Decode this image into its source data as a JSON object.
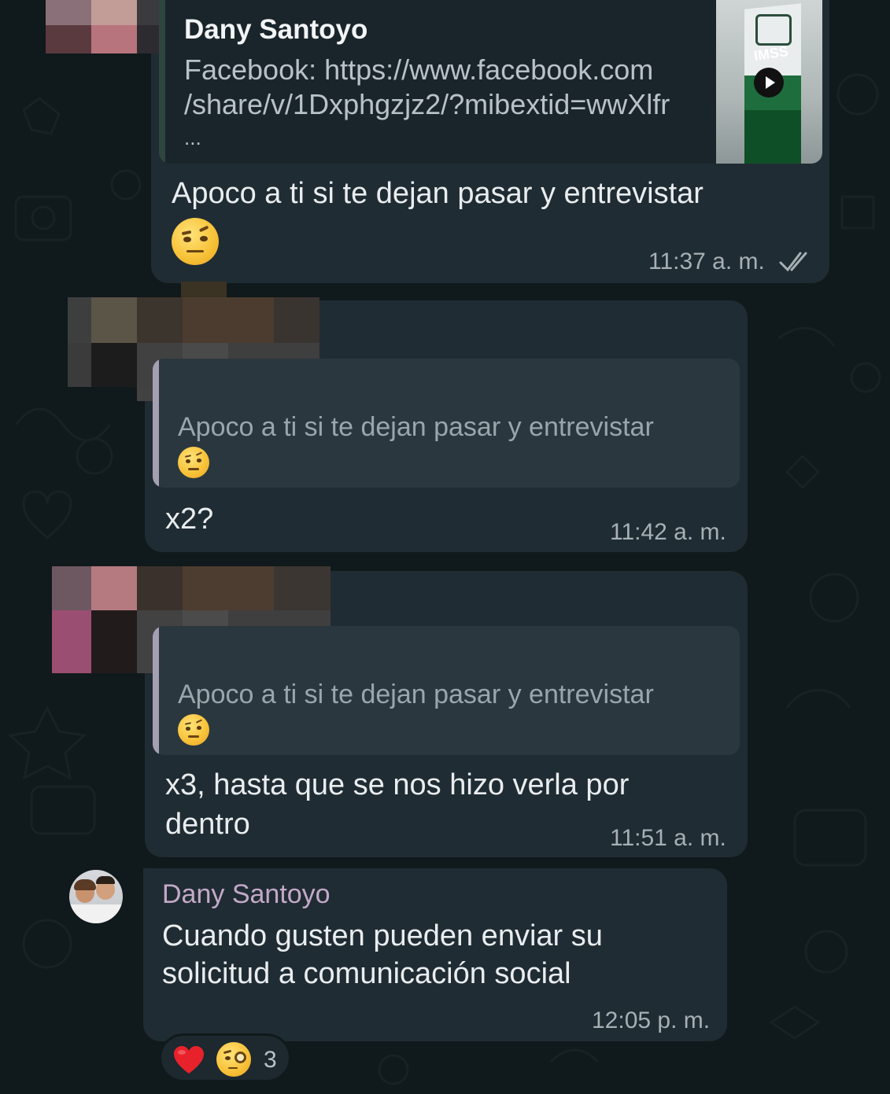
{
  "colors": {
    "background": "#10191b",
    "bubble": "#202c33",
    "quote_bg": "#2a373f",
    "quote_bar": "#a59fb2",
    "sender_name": "#c3a9c9",
    "read_ticks": "#a6b0b5"
  },
  "message1": {
    "sender": "Dany Santoyo",
    "link_line1": "Facebook: https://www.facebook.com",
    "link_line2": "/share/v/1Dxphgzjz2/?mibextid=wwXlfr",
    "link_more": "...",
    "thumbnail_logo": "IMSS",
    "thumbnail_icon": "play-icon",
    "text": "Apoco a ti si te dejan pasar y entrevistar",
    "emoji": "face-with-raised-eyebrow",
    "time": "11:37 a. m.",
    "status_icon": "double-check-icon"
  },
  "message2": {
    "quote_text": "Apoco a ti si te dejan pasar y entrevistar",
    "quote_emoji": "face-with-raised-eyebrow",
    "text": "x2?",
    "time": "11:42 a. m."
  },
  "message3": {
    "quote_text": "Apoco a ti si te dejan pasar y entrevistar",
    "quote_emoji": "face-with-raised-eyebrow",
    "text_line1": "x3, hasta que se nos hizo verla por",
    "text_line2": "dentro",
    "time": "11:51 a. m."
  },
  "message4": {
    "sender": "Dany Santoyo",
    "avatar": "avatar",
    "text_line1": "Cuando gusten pueden enviar su",
    "text_line2": "solicitud a comunicación social",
    "time": "12:05 p. m."
  },
  "reactions": {
    "emojis": [
      "red-heart",
      "face-with-monocle"
    ],
    "count": "3"
  }
}
